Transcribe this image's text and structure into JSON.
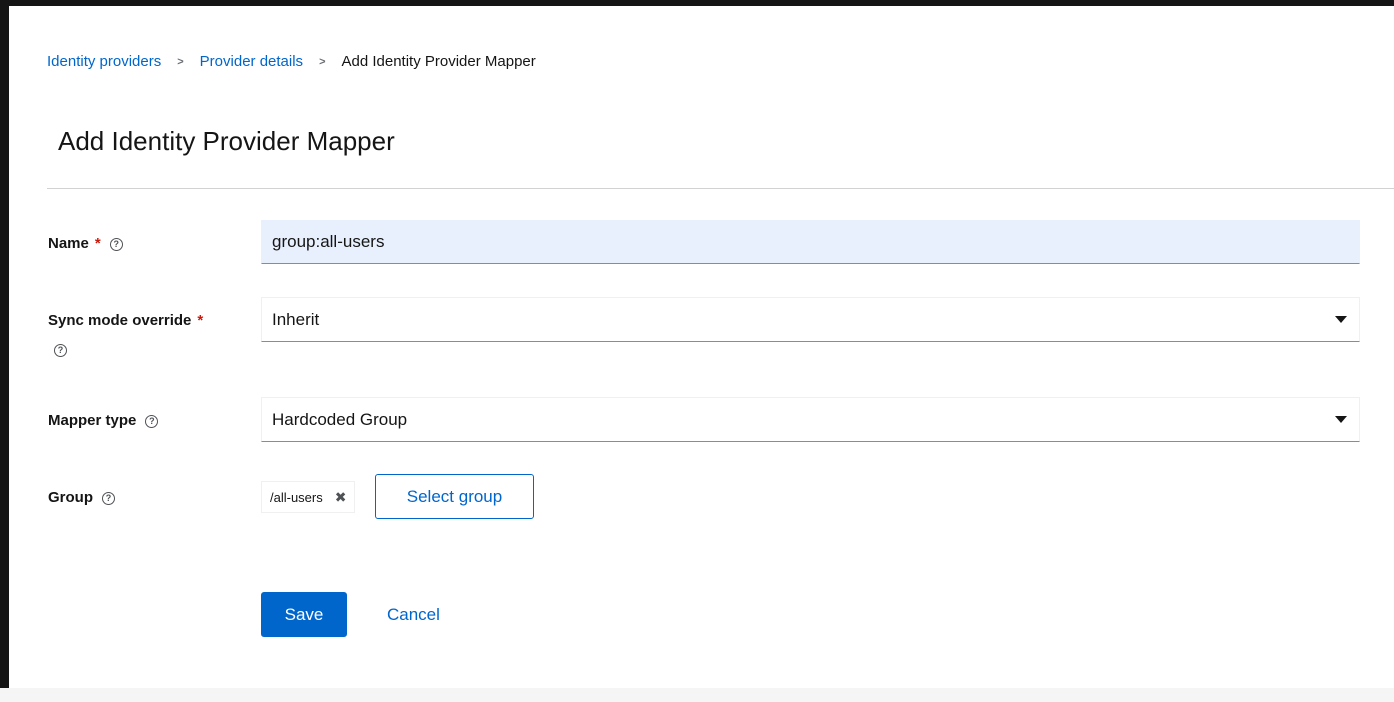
{
  "breadcrumb": {
    "items": [
      "Identity providers",
      "Provider details"
    ],
    "current": "Add Identity Provider Mapper",
    "separator": ">"
  },
  "page": {
    "title": "Add Identity Provider Mapper"
  },
  "form": {
    "name": {
      "label": "Name",
      "required_mark": "*",
      "value": "group:all-users"
    },
    "sync_mode": {
      "label": "Sync mode override",
      "required_mark": "*",
      "value": "Inherit"
    },
    "mapper_type": {
      "label": "Mapper type",
      "value": "Hardcoded Group"
    },
    "group": {
      "label": "Group",
      "chip": "/all-users",
      "chip_remove": "✖",
      "select_label": "Select group"
    },
    "help_icon": "?"
  },
  "actions": {
    "save_label": "Save",
    "cancel_label": "Cancel"
  },
  "colors": {
    "accent": "#0066cc",
    "required": "#c9190b",
    "autofill": "#e8f0fe"
  }
}
